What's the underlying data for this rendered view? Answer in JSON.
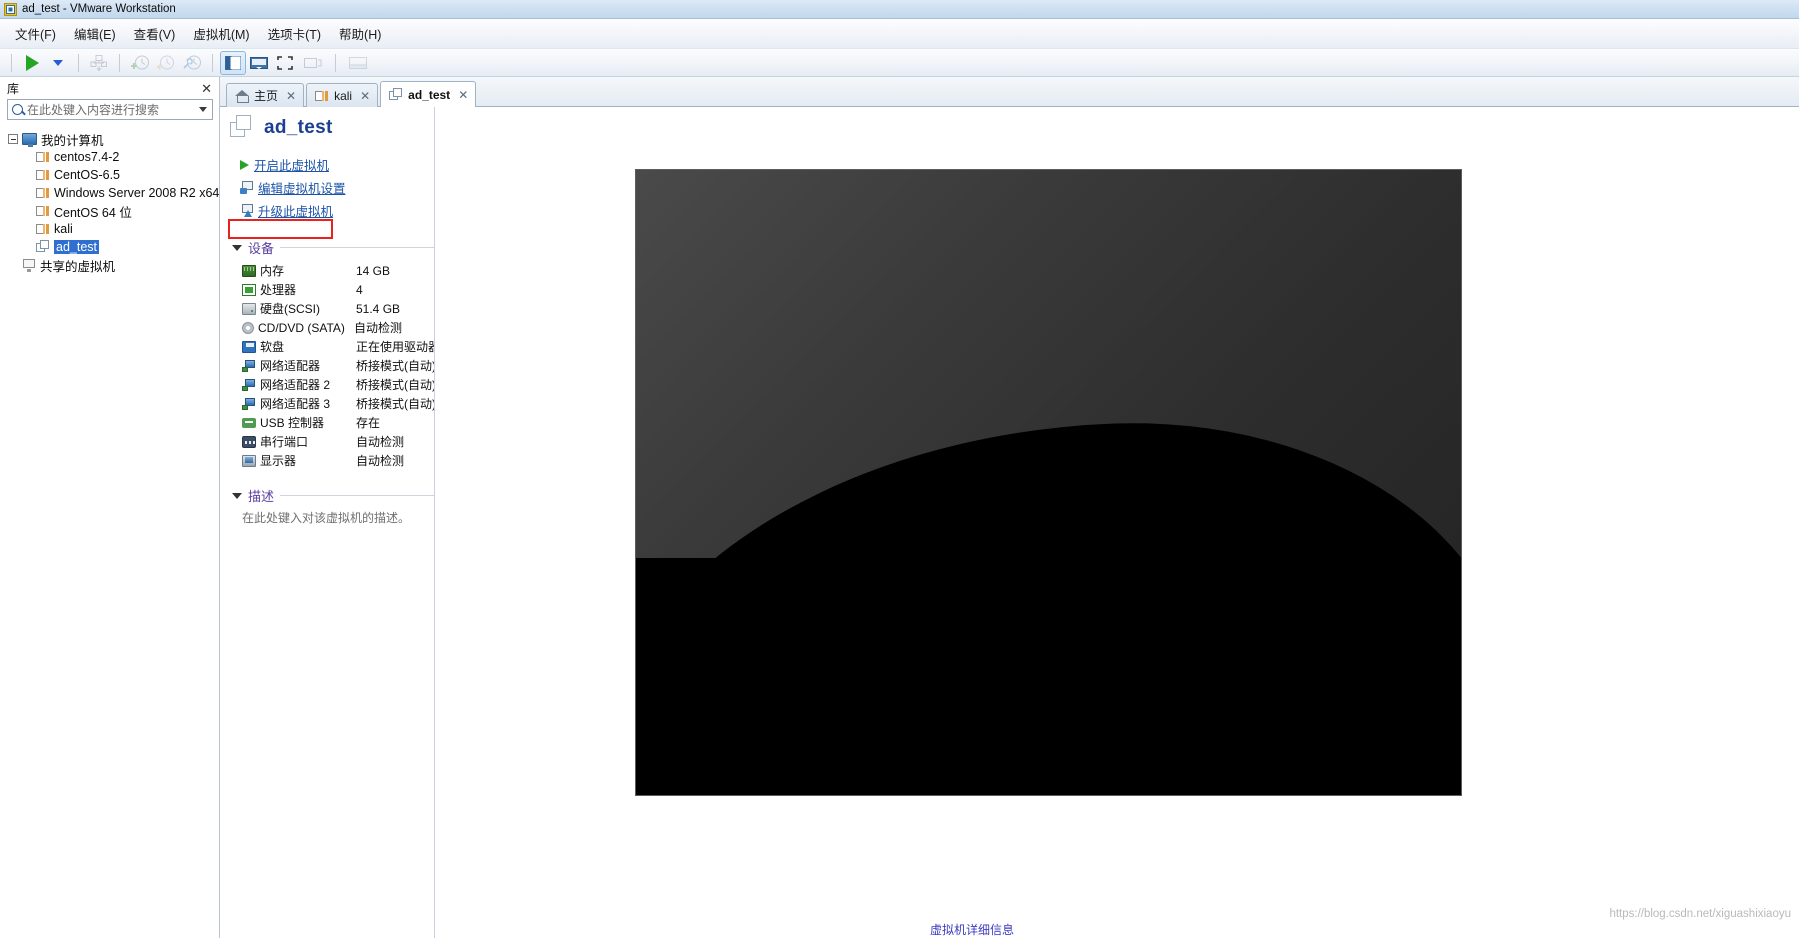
{
  "window": {
    "title": "ad_test - VMware Workstation",
    "app_icon": "vmware-app-icon"
  },
  "menubar": {
    "items": [
      {
        "label": "文件(F)",
        "name": "menu-file"
      },
      {
        "label": "编辑(E)",
        "name": "menu-edit"
      },
      {
        "label": "查看(V)",
        "name": "menu-view"
      },
      {
        "label": "虚拟机(M)",
        "name": "menu-vm"
      },
      {
        "label": "选项卡(T)",
        "name": "menu-tabs"
      },
      {
        "label": "帮助(H)",
        "name": "menu-help"
      }
    ]
  },
  "toolbar": {
    "buttons": [
      {
        "name": "power-on-button",
        "icon": "play-triangle-icon",
        "enabled": true
      },
      {
        "name": "power-dropdown-button",
        "icon": "chevron-down-icon",
        "enabled": true
      },
      {
        "name": "manage-snapshot-button",
        "icon": "snapshot-manage-icon",
        "enabled": false
      },
      {
        "name": "take-snapshot-button",
        "icon": "snapshot-add-icon",
        "enabled": false
      },
      {
        "name": "revert-snapshot-button",
        "icon": "snapshot-revert-icon",
        "enabled": false
      },
      {
        "name": "snapshot-manager-button",
        "icon": "snapshot-settings-icon",
        "enabled": false
      },
      {
        "name": "show-library-button",
        "icon": "sidebar-panel-icon",
        "enabled": true,
        "active": true
      },
      {
        "name": "show-console-view-button",
        "icon": "console-view-icon",
        "enabled": true
      },
      {
        "name": "fullscreen-button",
        "icon": "fullscreen-icon",
        "enabled": true
      },
      {
        "name": "unity-mode-button",
        "icon": "unity-mode-icon",
        "enabled": false
      },
      {
        "name": "thumbnail-bar-button",
        "icon": "thumbnail-bar-icon",
        "enabled": false
      }
    ]
  },
  "library": {
    "header_title": "库",
    "close_label": "✕",
    "search": {
      "placeholder": "在此处键入内容进行搜索",
      "value": ""
    },
    "tree": {
      "root": {
        "label": "我的计算机",
        "icon": "my-computer-icon",
        "expanded": true
      },
      "vms": [
        {
          "label": "centos7.4-2",
          "icon": "vm-icon",
          "selected": false
        },
        {
          "label": "CentOS-6.5",
          "icon": "vm-icon",
          "selected": false
        },
        {
          "label": "Windows Server 2008 R2 x64",
          "icon": "vm-icon",
          "selected": false
        },
        {
          "label": "CentOS 64 位",
          "icon": "vm-icon",
          "selected": false
        },
        {
          "label": "kali",
          "icon": "vm-icon",
          "selected": false
        },
        {
          "label": "ad_test",
          "icon": "vm-icon-plain",
          "selected": true
        }
      ],
      "shared": {
        "label": "共享的虚拟机",
        "icon": "shared-vm-icon"
      }
    }
  },
  "tabs": [
    {
      "label": "主页",
      "icon": "home-icon",
      "active": false,
      "closable": true
    },
    {
      "label": "kali",
      "icon": "vm-icon",
      "active": false,
      "closable": true
    },
    {
      "label": "ad_test",
      "icon": "vm-icon-plain",
      "active": true,
      "closable": true
    }
  ],
  "vm_summary": {
    "title": "ad_test",
    "title_icon": "vm-large-icon",
    "actions": [
      {
        "label": "开启此虚拟机",
        "icon": "play-triangle-icon",
        "name": "power-on-vm-link",
        "highlighted": true
      },
      {
        "label": "编辑虚拟机设置",
        "icon": "vm-settings-icon",
        "name": "edit-vm-settings-link",
        "highlighted": false
      },
      {
        "label": "升级此虚拟机",
        "icon": "vm-upgrade-icon",
        "name": "upgrade-vm-link",
        "highlighted": false
      }
    ],
    "devices_section": {
      "title": "设备",
      "expanded": true,
      "rows": [
        {
          "name": "内存",
          "value": "14 GB",
          "icon": "memory-icon"
        },
        {
          "name": "处理器",
          "value": "4",
          "icon": "cpu-icon"
        },
        {
          "name": "硬盘(SCSI)",
          "value": "51.4 GB",
          "icon": "harddisk-icon"
        },
        {
          "name": "CD/DVD (SATA)",
          "value": "自动检测",
          "icon": "cdrom-icon"
        },
        {
          "name": "软盘",
          "value": "正在使用驱动器 ...",
          "icon": "floppy-icon"
        },
        {
          "name": "网络适配器",
          "value": "桥接模式(自动)",
          "icon": "network-icon"
        },
        {
          "name": "网络适配器 2",
          "value": "桥接模式(自动)",
          "icon": "network-icon"
        },
        {
          "name": "网络适配器 3",
          "value": "桥接模式(自动)",
          "icon": "network-icon"
        },
        {
          "name": "USB 控制器",
          "value": "存在",
          "icon": "usb-icon"
        },
        {
          "name": "串行端口",
          "value": "自动检测",
          "icon": "serial-port-icon"
        },
        {
          "name": "显示器",
          "value": "自动检测",
          "icon": "display-icon"
        }
      ]
    },
    "description_section": {
      "title": "描述",
      "expanded": true,
      "placeholder": "在此处键入对该虚拟机的描述。"
    },
    "footer_label": "虚拟机详细信息",
    "preview": {
      "name": "vm-screen-preview",
      "background_top": "#4a4a4a",
      "background_bottom": "#000000"
    }
  },
  "watermark": "https://blog.csdn.net/xiguashixiaoyu",
  "colors": {
    "accent_blue": "#1c3f94",
    "link_blue": "#1b53a8",
    "section_purple": "#5a3fa0",
    "highlight_red": "#e8221f",
    "selection_blue": "#2f6fd0",
    "play_green": "#27a427"
  }
}
